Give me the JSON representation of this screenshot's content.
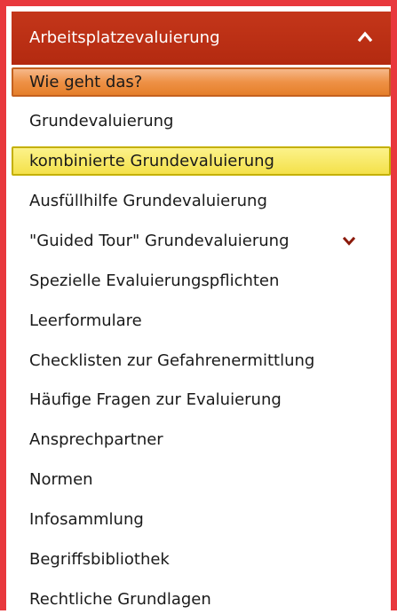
{
  "header": {
    "title": "Arbeitsplatzevaluierung",
    "toggle_icon": "chevron-up-icon"
  },
  "menu": {
    "items": [
      {
        "label": "Wie geht das?"
      },
      {
        "label": "Grundevaluierung"
      },
      {
        "label": "kombinierte Grundevaluierung"
      },
      {
        "label": "Ausfüllhilfe Grundevaluierung"
      },
      {
        "label": "\"Guided Tour\" Grundevaluierung",
        "icon": "chevron-down-icon"
      },
      {
        "label": "Spezielle Evaluierungspflichten"
      },
      {
        "label": "Leerformulare"
      },
      {
        "label": "Checklisten zur Gefahrenermittlung"
      },
      {
        "label": "Häufige Fragen zur Evaluierung"
      },
      {
        "label": "Ansprechpartner"
      },
      {
        "label": "Normen"
      },
      {
        "label": "Infosammlung"
      },
      {
        "label": "Begriffsbibliothek"
      },
      {
        "label": "Rechtliche Grundlagen"
      }
    ]
  },
  "colors": {
    "frame": "#e8383d",
    "header": "#b32a10",
    "active_item": "#ee9146",
    "hover_item": "#f4e14a",
    "expand_chevron": "#8b1a0a"
  }
}
